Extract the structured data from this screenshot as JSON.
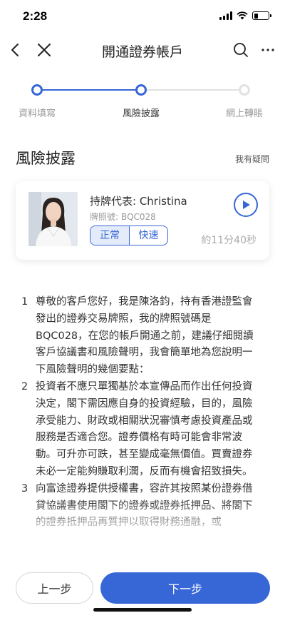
{
  "status_bar": {
    "time": "2:28",
    "battery_level": 0.3
  },
  "nav": {
    "title": "開通證券帳戶",
    "back_icon": "chevron-left-icon",
    "close_icon": "close-icon",
    "search_icon": "search-icon",
    "more_icon": "more-icon"
  },
  "steps": [
    {
      "label": "資料填寫",
      "state": "done"
    },
    {
      "label": "風險披露",
      "state": "current"
    },
    {
      "label": "網上轉賬",
      "state": "todo"
    }
  ],
  "section": {
    "title": "風險披露",
    "help": "我有疑問"
  },
  "agent": {
    "name": "持牌代表: Christina",
    "license": "牌照號: BQC028",
    "speed_normal": "正常",
    "speed_fast": "快速",
    "selected_speed": "正常",
    "duration": "約11分40秒",
    "play_icon": "play-icon"
  },
  "transcript": [
    {
      "num": "1",
      "text": "尊敬的客戶您好，我是陳洛鈞，持有香港證監會發出的證券交易牌照，我的牌照號碼是BQC028，在您的帳戶開通之前，建議仔細閱讀客戶協議書和風險聲明，我會簡單地為您說明一下風險聲明的幾個要點："
    },
    {
      "num": "2",
      "text": "投資者不應只單獨基於本宣傳品而作出任何投資決定，閣下需因應自身的投資經驗，目的，風險承受能力、財政或相關狀況審慎考慮投資產品或服務是否適合您。證券價格有時可能會非常波動。可升亦可跌，甚至變成毫無價值。買賣證券未必一定能夠賺取利潤，反而有機會招致損失。"
    },
    {
      "num": "3",
      "text": "向富途證券提供授權書，容許其按照某份證券借貸協議書使用閣下的證券或證券抵押品、將閣下的證券抵押品再質押以取得財務通融，或"
    }
  ],
  "buttons": {
    "prev": "上一步",
    "next": "下一步"
  },
  "colors": {
    "accent": "#3766d6",
    "inactive": "#e2e2e2"
  }
}
